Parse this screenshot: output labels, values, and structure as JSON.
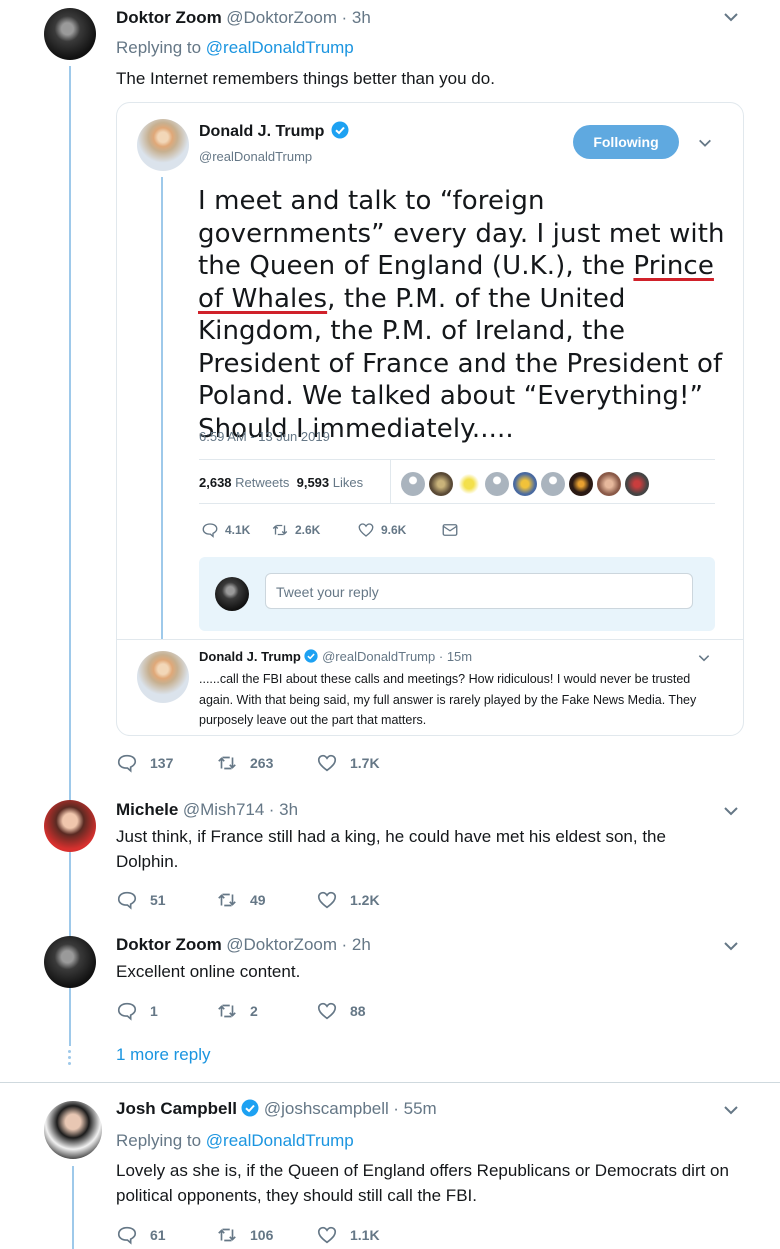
{
  "thread": {
    "tweet1": {
      "name": "Doktor Zoom",
      "handle": "@DoktorZoom",
      "time": "· 3h",
      "replying_prefix": "Replying to",
      "replying_to": "@realDonaldTrump",
      "text": "The Internet remembers things better than you do.",
      "counts": {
        "replies": "137",
        "retweets": "263",
        "likes": "1.7K"
      }
    },
    "quoted": {
      "name": "Donald J. Trump",
      "handle": "@realDonaldTrump",
      "follow_label": "Following",
      "text_before": "I meet and talk to “foreign governments” every day. I just met with the Queen of England (U.K.), the ",
      "text_underlined": "Prince of Whales",
      "text_after": ", the P.M. of the United Kingdom, the P.M. of Ireland, the President of France and the President of Poland. We talked about “Everything!” Should I immediately.....",
      "timestamp": "6:59 AM - 13 Jun 2019",
      "retweets_count": "2,638",
      "retweets_label": "Retweets",
      "likes_count": "9,593",
      "likes_label": "Likes",
      "actions": {
        "replies": "4.1K",
        "retweets": "2.6K",
        "likes": "9.6K"
      },
      "reply_placeholder": "Tweet your reply",
      "followup": {
        "name": "Donald J. Trump",
        "handle": "@realDonaldTrump",
        "time": "· 15m",
        "text": "......call the FBI about these calls and meetings? How ridiculous! I would never be trusted again. With that being said, my full answer is rarely played by the Fake News Media. They purposely leave out the part that matters."
      }
    },
    "tweet2": {
      "name": "Michele",
      "handle": "@Mish714",
      "time": "· 3h",
      "text": "Just think, if France still had a king, he could have met his eldest son, the Dolphin.",
      "counts": {
        "replies": "51",
        "retweets": "49",
        "likes": "1.2K"
      }
    },
    "tweet3": {
      "name": "Doktor Zoom",
      "handle": "@DoktorZoom",
      "time": "· 2h",
      "text": "Excellent online content.",
      "counts": {
        "replies": "1",
        "retweets": "2",
        "likes": "88"
      }
    },
    "more_replies": "1 more reply",
    "tweet4": {
      "name": "Josh Campbell",
      "handle": "@joshscampbell",
      "time": "· 55m",
      "replying_prefix": "Replying to",
      "replying_to": "@realDonaldTrump",
      "text": "Lovely as she is, if the Queen of England offers Republicans or Democrats dirt on political opponents, they should still call the FBI.",
      "counts": {
        "replies": "61",
        "retweets": "106",
        "likes": "1.1K"
      }
    }
  },
  "colors": {
    "accent": "#1b95e0",
    "verified": "#1da1f2",
    "underline": "#d0212a",
    "thread_line": "#9ec9ea"
  },
  "icons": [
    "reply-icon",
    "retweet-icon",
    "like-icon",
    "dm-icon",
    "verified-badge-icon",
    "chevron-down-icon"
  ]
}
